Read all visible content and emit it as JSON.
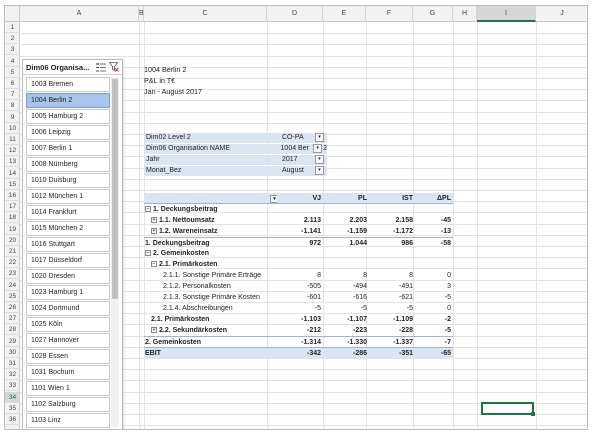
{
  "columns": [
    "A",
    "B",
    "C",
    "D",
    "E",
    "F",
    "G",
    "H",
    "I",
    "J"
  ],
  "rows": [
    "1",
    "2",
    "3",
    "4",
    "5",
    "6",
    "7",
    "8",
    "9",
    "10",
    "11",
    "12",
    "13",
    "14",
    "15",
    "16",
    "17",
    "18",
    "19",
    "20",
    "21",
    "22",
    "23",
    "24",
    "25",
    "26",
    "27",
    "28",
    "29",
    "30",
    "31",
    "32",
    "33",
    "34",
    "35",
    "36"
  ],
  "selected_row": "34",
  "selected_col": "I",
  "slicer": {
    "title": "Dim06 Organisa...",
    "multiselect_icon": "multi-select-icon",
    "clear_filter_icon": "clear-filter-icon",
    "items": [
      "1003 Bremen",
      "1004 Berlin 2",
      "1005 Hamburg 2",
      "1006 Leipzig",
      "1007 Berlin 1",
      "1008 Nürnberg",
      "1010 Duisburg",
      "1012 München 1",
      "1014 Frankfurt",
      "1015 München 2",
      "1016 Stuttgart",
      "1017 Düsseldorf",
      "1020 Dresden",
      "1023 Hamburg 1",
      "1024 Dortmund",
      "1025 Köln",
      "1027 Hannover",
      "1028 Essen",
      "1031 Bochum",
      "1101 Wien 1",
      "1102 Salzburg",
      "1103 Linz"
    ],
    "selected_index": 1
  },
  "report": {
    "line1": "1004 Berlin 2",
    "line2": "P&L in T€",
    "line3": "Jan - August 2017"
  },
  "filters": [
    {
      "label": "Dim02 Level 2",
      "value": "CO-PA"
    },
    {
      "label": "Dim06 Organisation NAME",
      "value": "1004 Ber",
      "suffix": "2"
    },
    {
      "label": "Jahr",
      "value": "2017"
    },
    {
      "label": "Monat_Bez",
      "value": "August"
    }
  ],
  "pivot": {
    "headers": [
      "VJ",
      "PL",
      "IST",
      "ΔPL"
    ],
    "rows": [
      {
        "label": "1. Deckungsbeitrag",
        "indent": 0,
        "toggle": "⊟",
        "values": [
          "",
          "",
          "",
          ""
        ],
        "style": "bold"
      },
      {
        "label": "1.1. Nettoumsatz",
        "indent": 1,
        "toggle": "⊞",
        "values": [
          "2.113",
          "2.203",
          "2.158",
          "-45"
        ],
        "style": "bold"
      },
      {
        "label": "1.2. Wareneinsatz",
        "indent": 1,
        "toggle": "⊞",
        "values": [
          "-1.141",
          "-1.159",
          "-1.172",
          "-13"
        ],
        "style": "bold"
      },
      {
        "label": "1. Deckungsbeitrag",
        "indent": 0,
        "toggle": "",
        "values": [
          "972",
          "1.044",
          "986",
          "-58"
        ],
        "style": "total"
      },
      {
        "label": "2. Gemeinkosten",
        "indent": 0,
        "toggle": "⊟",
        "values": [
          "",
          "",
          "",
          ""
        ],
        "style": "bold"
      },
      {
        "label": "2.1. Primärkosten",
        "indent": 1,
        "toggle": "⊟",
        "values": [
          "",
          "",
          "",
          ""
        ],
        "style": "bold"
      },
      {
        "label": "2.1.1. Sonstige Primäre Erträge",
        "indent": 3,
        "toggle": "",
        "values": [
          "8",
          "8",
          "8",
          "0"
        ],
        "style": ""
      },
      {
        "label": "2.1.2. Personalkosten",
        "indent": 3,
        "toggle": "",
        "values": [
          "-505",
          "-494",
          "-491",
          "3"
        ],
        "style": ""
      },
      {
        "label": "2.1.3. Sonstige Primäre Kosten",
        "indent": 3,
        "toggle": "",
        "values": [
          "-601",
          "-616",
          "-621",
          "-5"
        ],
        "style": ""
      },
      {
        "label": "2.1.4. Abschreibungen",
        "indent": 3,
        "toggle": "",
        "values": [
          "-5",
          "-5",
          "-5",
          "0"
        ],
        "style": ""
      },
      {
        "label": "2.1. Primärkosten",
        "indent": 1,
        "toggle": "",
        "values": [
          "-1.103",
          "-1.107",
          "-1.109",
          "-2"
        ],
        "style": "bold"
      },
      {
        "label": "2.2. Sekundärkosten",
        "indent": 1,
        "toggle": "⊞",
        "values": [
          "-212",
          "-223",
          "-228",
          "-5"
        ],
        "style": "bold"
      },
      {
        "label": "2. Gemeinkosten",
        "indent": 0,
        "toggle": "",
        "values": [
          "-1.314",
          "-1.330",
          "-1.337",
          "-7"
        ],
        "style": "total"
      },
      {
        "label": "EBIT",
        "indent": 0,
        "toggle": "",
        "values": [
          "-342",
          "-286",
          "-351",
          "-65"
        ],
        "style": "grand"
      }
    ]
  },
  "colors": {
    "accent": "#217346",
    "slicer_selected": "#a9c4ea",
    "pivot_header": "#dbe4f3"
  }
}
